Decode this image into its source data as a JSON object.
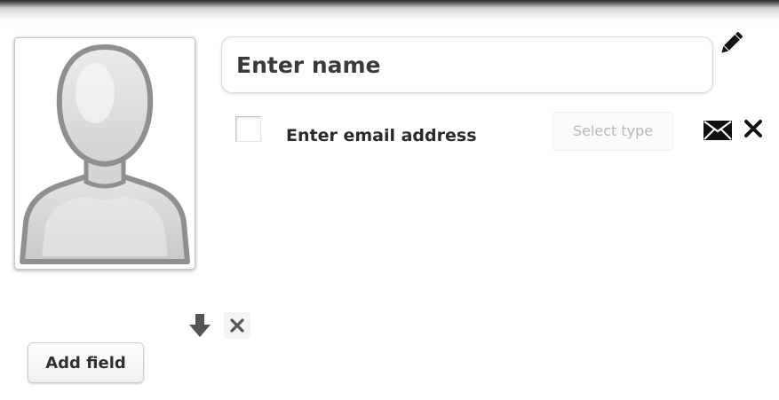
{
  "contact": {
    "avatar_icon": "person-silhouette-icon",
    "name_placeholder": "Enter name",
    "name_value": "",
    "edit_icon": "pencil-icon"
  },
  "email_row": {
    "checked": false,
    "email_placeholder": "Enter email address",
    "email_value": "",
    "type_select_label": "Select type",
    "type_icon": "envelope-icon",
    "remove_icon": "close-icon"
  },
  "field_controls": {
    "move_down_icon": "down-arrow-icon",
    "remove_icon": "close-icon",
    "add_field_label": "Add field"
  },
  "colors": {
    "text_primary": "#2b2b2b",
    "placeholder_muted": "#b9b9b9",
    "icon_dark": "#111111",
    "icon_gray": "#555555"
  }
}
